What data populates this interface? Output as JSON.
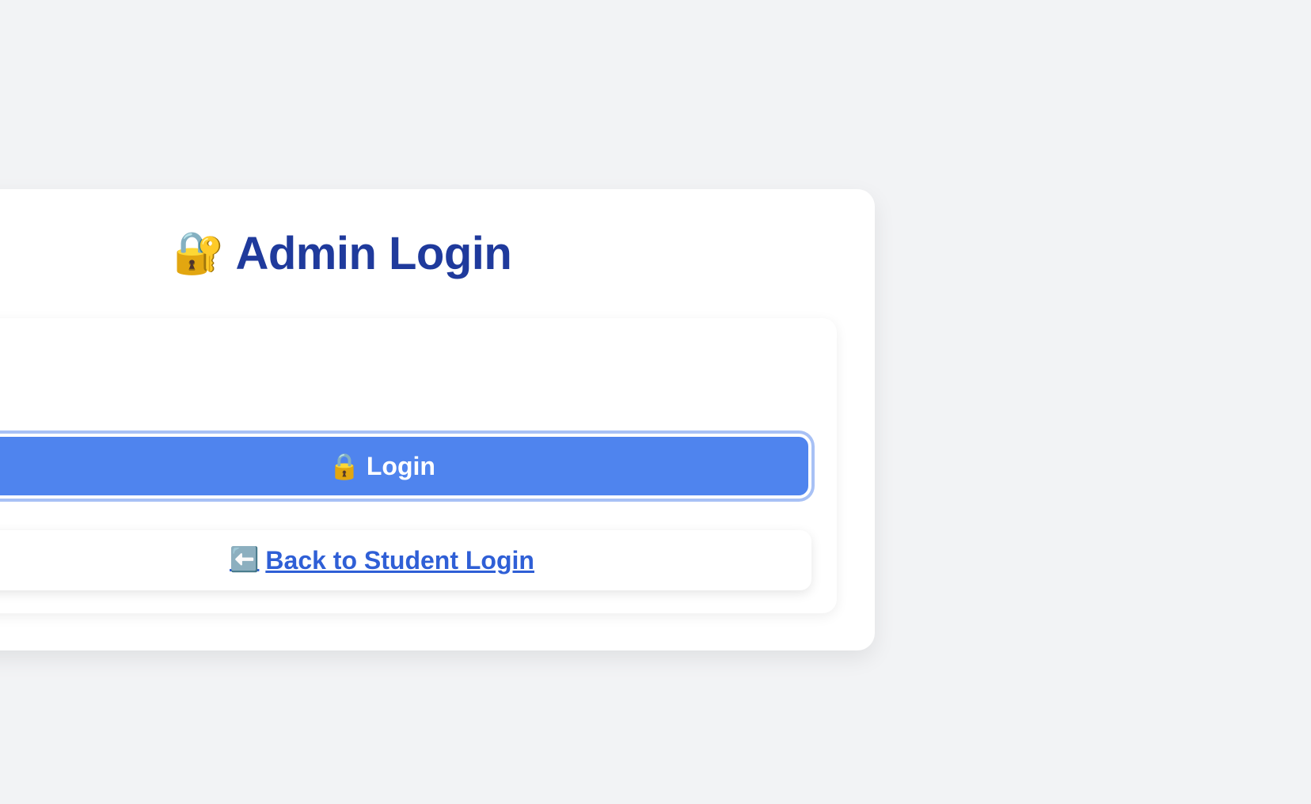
{
  "page": {
    "title_icon": "🔐",
    "title_icon_name": "locked-with-key-icon",
    "title": "Admin Login"
  },
  "form": {
    "login_button": {
      "icon": "🔒",
      "icon_name": "lock-icon",
      "label": "Login"
    },
    "back_link": {
      "icon": "⬅️",
      "icon_name": "left-arrow-icon",
      "label": "Back to Student Login"
    }
  },
  "colors": {
    "background": "#f2f3f5",
    "title": "#1f3a9c",
    "button": "#4f84ee",
    "link": "#2f5fd6"
  }
}
